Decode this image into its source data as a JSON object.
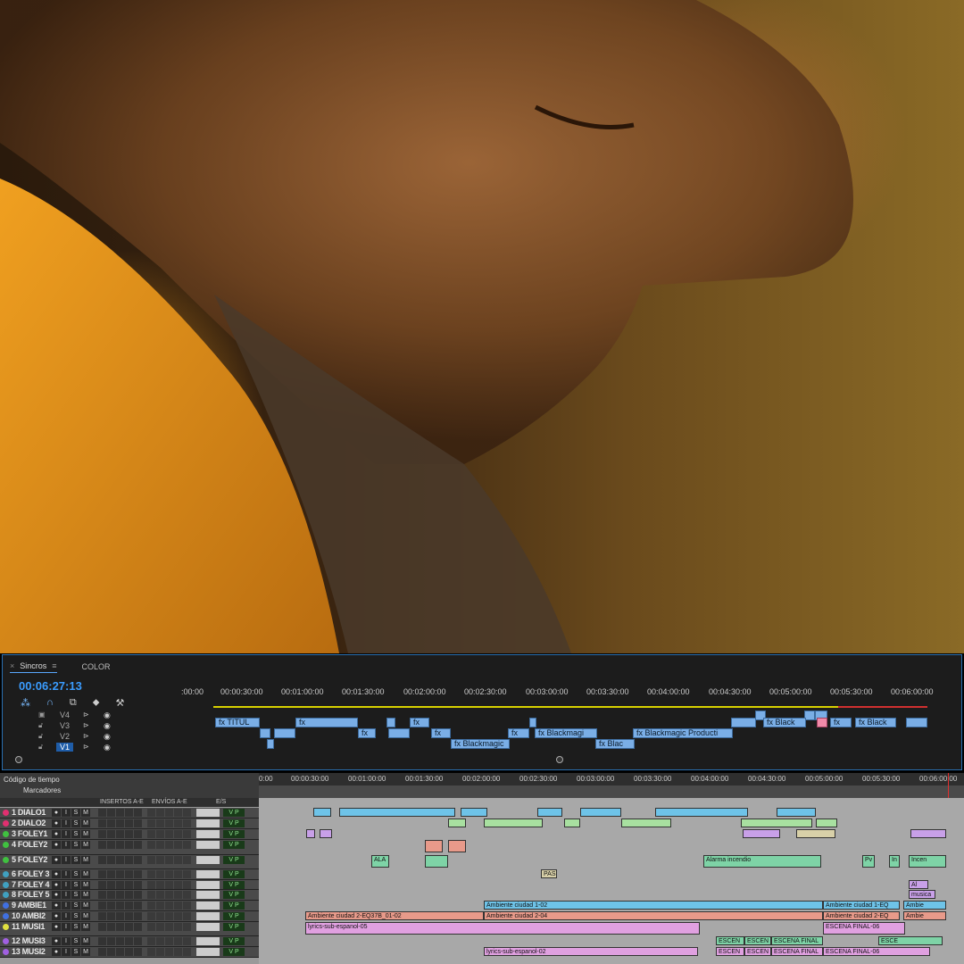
{
  "premiere": {
    "tabs": [
      {
        "label": "Sincros",
        "close": "×",
        "menu": "≡",
        "active": true
      },
      {
        "label": "COLOR",
        "active": false
      }
    ],
    "timecode": "00:06:27:13",
    "ruler_ticks": [
      ":00:00",
      "00:00:30:00",
      "00:01:00:00",
      "00:01:30:00",
      "00:02:00:00",
      "00:02:30:00",
      "00:03:00:00",
      "00:03:30:00",
      "00:04:00:00",
      "00:04:30:00",
      "00:05:00:00",
      "00:05:30:00",
      "00:06:00:00"
    ],
    "tracks": [
      {
        "name": "V4",
        "selected": false
      },
      {
        "name": "V3",
        "selected": false
      },
      {
        "name": "V2",
        "selected": false
      },
      {
        "name": "V1",
        "selected": true
      }
    ],
    "clip_labels": {
      "titulo": "TITUL",
      "blackmagic": "Blackmagic",
      "blackmagic_b": "Blackmagi",
      "blackmagic_prod": "Blackmagic Producti",
      "black": "Black",
      "black_b": "Blac",
      "fx": "fx"
    }
  },
  "protools": {
    "header": {
      "timecode_label": "Código de tiempo",
      "markers_label": "Marcadores"
    },
    "columns": {
      "inserts": "INSERTOS A-E",
      "sends": "ENVÍOS A-E",
      "io": "E/S"
    },
    "ruler_ticks": [
      "0:00",
      "00:00:30:00",
      "00:01:00:00",
      "00:01:30:00",
      "00:02:00:00",
      "00:02:30:00",
      "00:03:00:00",
      "00:03:30:00",
      "00:04:00:00",
      "00:04:30:00",
      "00:05:00:00",
      "00:05:30:00",
      "00:06:00:00"
    ],
    "track_buttons": {
      "rec": "●",
      "input": "I",
      "solo": "S",
      "mute": "M",
      "voice": "V",
      "play": "P"
    },
    "tracks": [
      {
        "name": "1 DIALO1",
        "color": "#e03070"
      },
      {
        "name": "2 DIALO2",
        "color": "#e03070"
      },
      {
        "name": "3 FOLEY1",
        "color": "#40c040"
      },
      {
        "name": "4 FOLEY2",
        "color": "#40c040"
      },
      {
        "name": "5 FOLEY2",
        "color": "#40c040"
      },
      {
        "name": "6 FOLEY 3",
        "color": "#40a0c0"
      },
      {
        "name": "7 FOLEY 4",
        "color": "#40a0c0"
      },
      {
        "name": "8 FOLEY 5",
        "color": "#40a0c0"
      },
      {
        "name": "9 AMBIE1",
        "color": "#4070e0"
      },
      {
        "name": "10 AMBI2",
        "color": "#4070e0"
      },
      {
        "name": "11 MUSI1",
        "color": "#e0e040"
      },
      {
        "name": "12 MUSI3",
        "color": "#a060e0"
      },
      {
        "name": "13 MUSI2",
        "color": "#a060e0"
      }
    ],
    "clip_labels": {
      "alarma": "Alarma incendio",
      "alarma_short": "ALA",
      "pas": "PAS",
      "pv": "Pv",
      "in": "In",
      "incen": "Incen",
      "al": "Al",
      "musica": "musica",
      "amb1": "Ambiente ciudad 1-02",
      "amb1eq": "Ambiente ciudad 1-EQ",
      "amb_short": "Ambie",
      "amb2eq": "Ambiente ciudad 2-EQ37B_01-02",
      "amb2": "Ambiente ciudad 2-04",
      "amb2eq_b": "Ambiente ciudad 2-EQ",
      "lyrics1": "lyrics-sub-espanol-05",
      "escena_final": "ESCENA FINAL-06",
      "escen": "ESCEN",
      "escena": "ESCENA FINAL",
      "esce": "ESCE",
      "lyrics2": "lyrics-sub-espanol-02"
    }
  }
}
